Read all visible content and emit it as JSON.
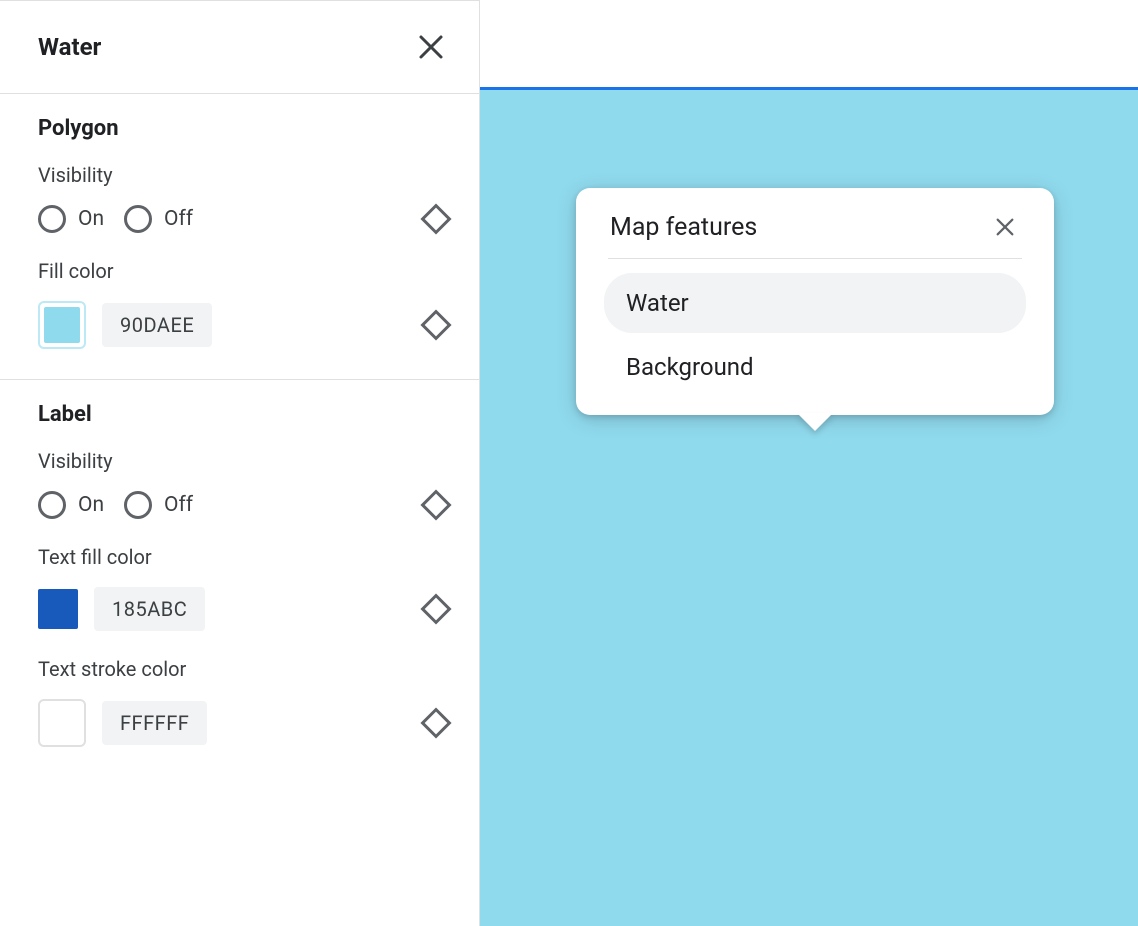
{
  "sidebar": {
    "title": "Water",
    "polygon": {
      "heading": "Polygon",
      "visibility_label": "Visibility",
      "visibility_on": "On",
      "visibility_off": "Off",
      "fill_label": "Fill color",
      "fill_hex": "90DAEE",
      "fill_swatch": "#90DAEE"
    },
    "label": {
      "heading": "Label",
      "visibility_label": "Visibility",
      "visibility_on": "On",
      "visibility_off": "Off",
      "text_fill_label": "Text fill color",
      "text_fill_hex": "185ABC",
      "text_fill_swatch": "#185ABC",
      "text_stroke_label": "Text stroke color",
      "text_stroke_hex": "FFFFFF",
      "text_stroke_swatch": "#FFFFFF"
    }
  },
  "map": {
    "water_color": "#90DAEE",
    "accent": "#1a73e8"
  },
  "popup": {
    "title": "Map features",
    "items": [
      {
        "label": "Water",
        "selected": true
      },
      {
        "label": "Background",
        "selected": false
      }
    ]
  }
}
